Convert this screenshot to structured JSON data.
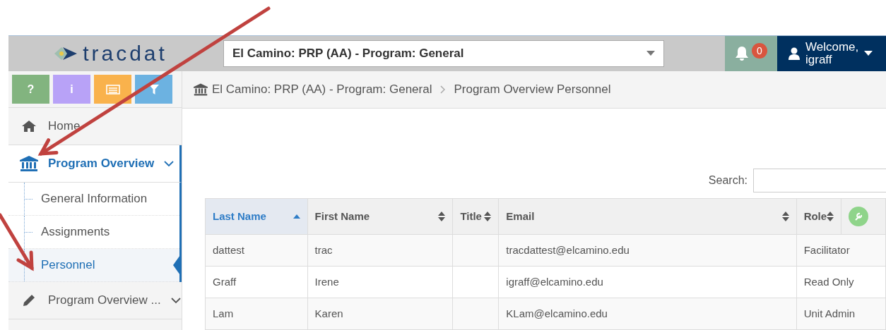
{
  "header": {
    "logo": "tracdat",
    "context_select": "El Camino: PRP (AA) - Program: General",
    "notifications": "0",
    "user": "Welcome,\nigraff"
  },
  "toolbar": [
    {
      "kind": "help",
      "label": "?"
    },
    {
      "kind": "info",
      "label": "i"
    },
    {
      "kind": "list"
    },
    {
      "kind": "filter"
    }
  ],
  "sidebar": {
    "items": [
      {
        "label": "Home",
        "kind": "home",
        "selected": false
      },
      {
        "label": "Program Overview",
        "kind": "institution",
        "selected": true,
        "submenu": true,
        "expanded": true,
        "children": [
          {
            "label": "General Information",
            "selected": false
          },
          {
            "label": "Assignments",
            "selected": false
          },
          {
            "label": "Personnel",
            "selected": true
          }
        ]
      },
      {
        "label": "Program Overview ...",
        "kind": "pencil",
        "selected": false,
        "submenu": true
      }
    ]
  },
  "breadcrumb": [
    "El Camino: PRP (AA) - Program: General",
    "Program Overview Personnel"
  ],
  "search": {
    "label": "Search:"
  },
  "table": {
    "columns": [
      {
        "label": "Last Name",
        "sorted": true
      },
      {
        "label": "First Name",
        "sorted": false
      },
      {
        "label": "Title",
        "sorted": false
      },
      {
        "label": "Email",
        "sorted": false
      },
      {
        "label": "Role",
        "sorted": false
      },
      {
        "kind": "tools"
      }
    ],
    "rows": [
      [
        "dattest",
        "trac",
        "",
        "tracdattest@elcamino.edu",
        "Facilitator"
      ],
      [
        "Graff",
        "Irene",
        "",
        "igraff@elcamino.edu",
        "Read Only"
      ],
      [
        "Lam",
        "Karen",
        "",
        "KLam@elcamino.edu",
        "Unit Admin"
      ]
    ]
  },
  "annotations": [
    {
      "kind": "arrow"
    },
    {
      "kind": "arrow"
    }
  ]
}
